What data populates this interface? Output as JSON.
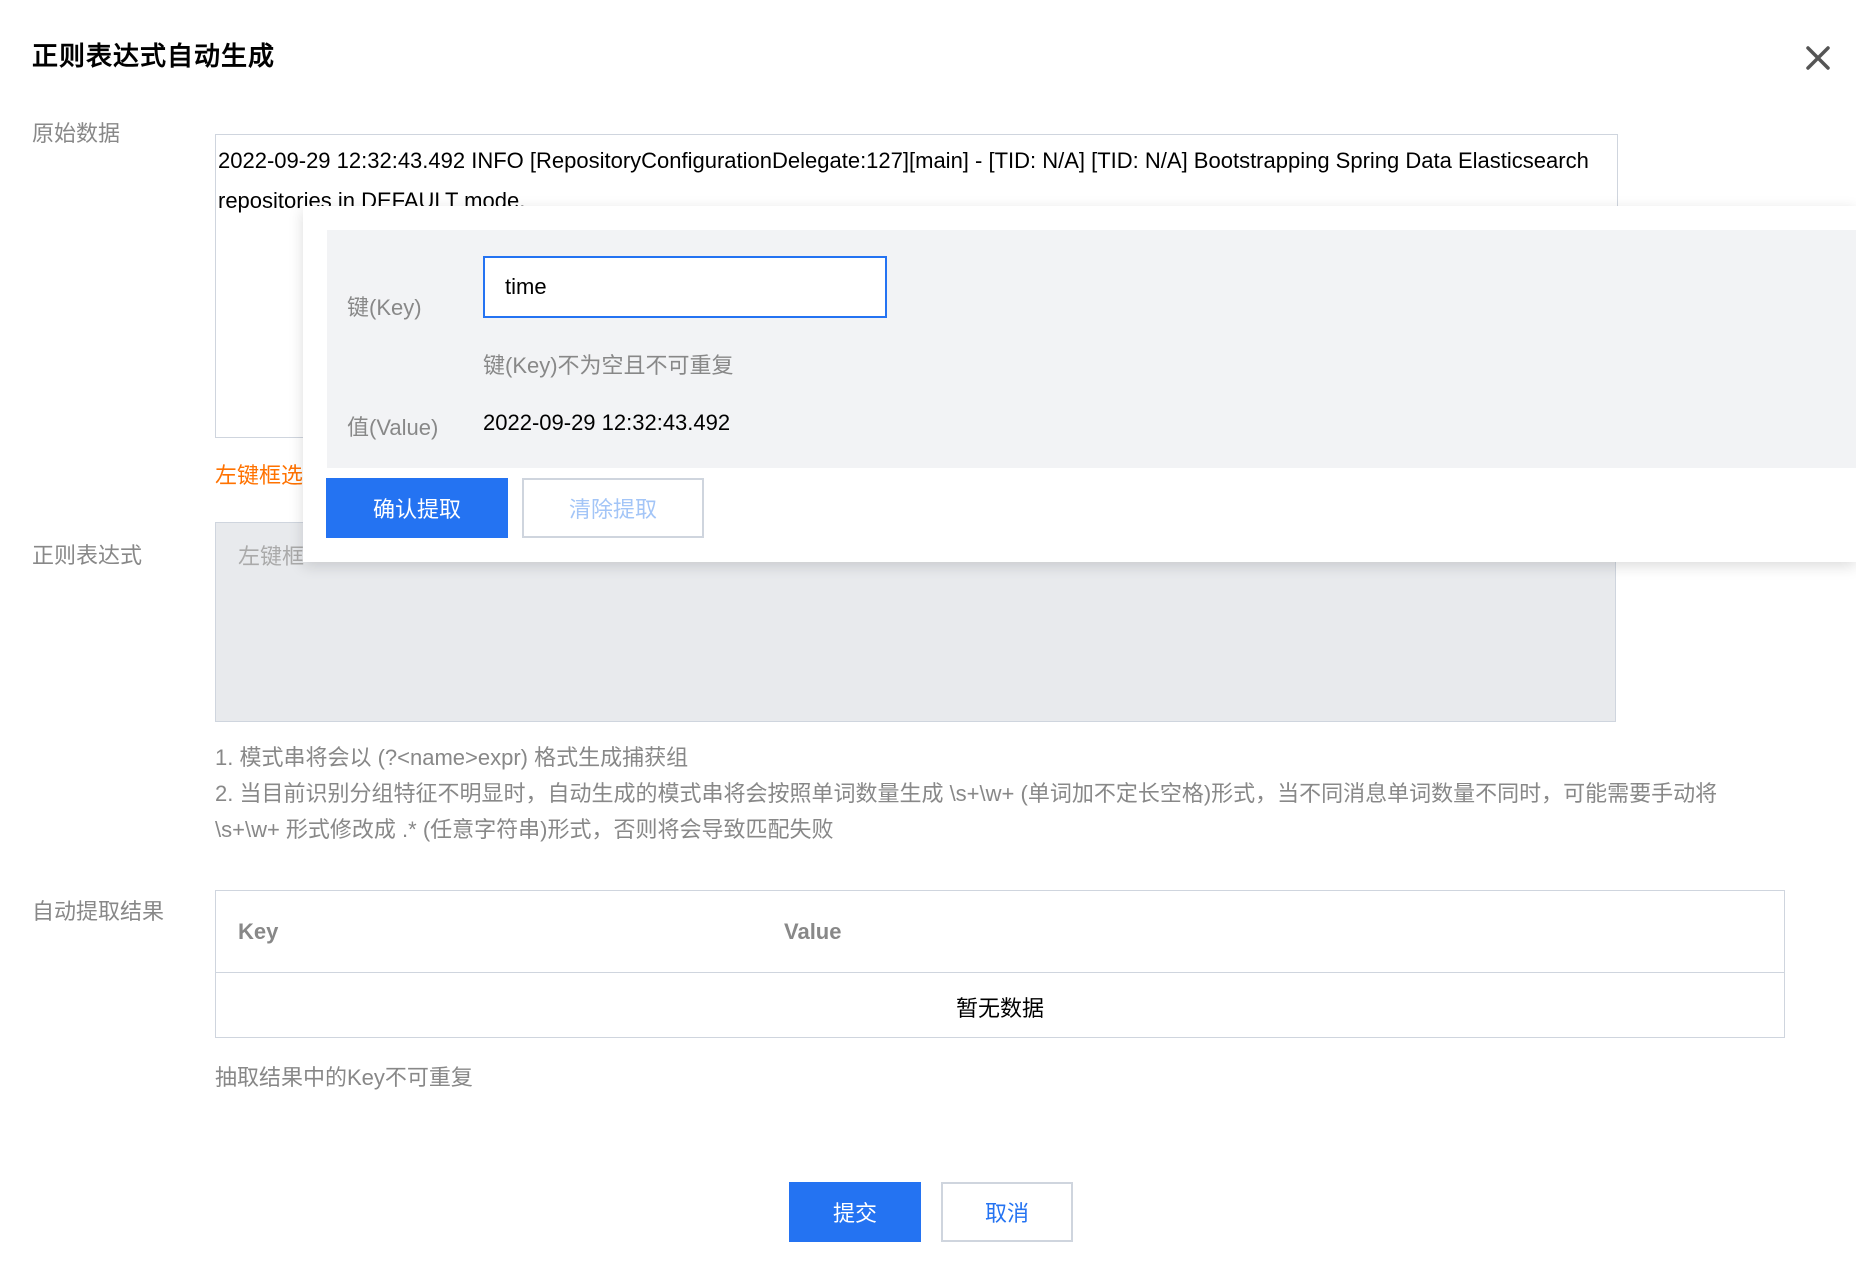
{
  "dialog": {
    "title": "正则表达式自动生成"
  },
  "raw": {
    "label": "原始数据",
    "text": "2022-09-29 12:32:43.492 INFO  [RepositoryConfigurationDelegate:127][main]  - [TID: N/A] [TID: N/A] Bootstrapping Spring Data Elasticsearch repositories in DEFAULT mode.",
    "hint_visible": "左键框选"
  },
  "regex": {
    "label": "正则表达式",
    "placeholder_visible": "左键框"
  },
  "notes": {
    "line1": "1. 模式串将会以 (?<name>expr) 格式生成捕获组",
    "line2": "2. 当目前识别分组特征不明显时，自动生成的模式串将会按照单词数量生成 \\s+\\w+ (单词加不定长空格)形式，当不同消息单词数量不同时，可能需要手动将 \\s+\\w+ 形式修改成 .* (任意字符串)形式，否则将会导致匹配失败"
  },
  "result": {
    "label": "自动提取结果",
    "columns": [
      "Key",
      "Value"
    ],
    "empty_text": "暂无数据",
    "hint": "抽取结果中的Key不可重复"
  },
  "footer": {
    "submit_label": "提交",
    "cancel_label": "取消"
  },
  "popover": {
    "key_label": "键(Key)",
    "key_value": "time",
    "key_hint": "键(Key)不为空且不可重复",
    "value_label": "值(Value)",
    "value_text": "2022-09-29 12:32:43.492",
    "confirm_label": "确认提取",
    "clear_label": "清除提取"
  },
  "colors": {
    "primary": "#2473f2",
    "hint_orange": "#ff7200",
    "muted_text": "#888888",
    "border": "#cfd5de"
  },
  "icons": {
    "close": "close-icon"
  }
}
